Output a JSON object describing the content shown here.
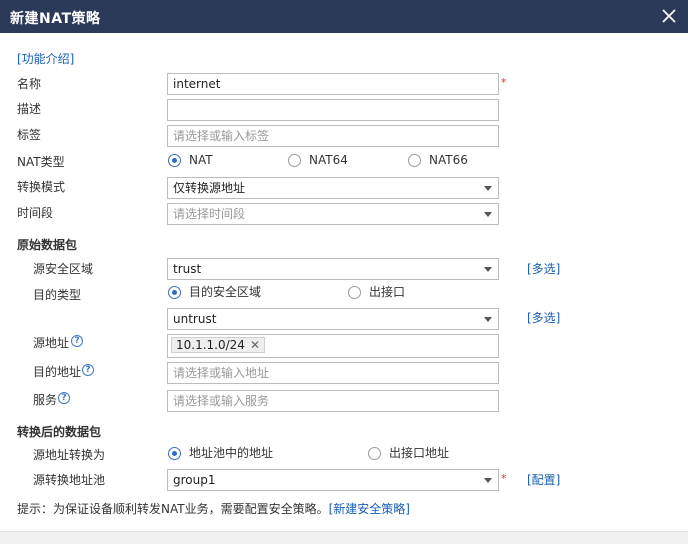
{
  "dialog": {
    "title": "新建NAT策略",
    "close_icon": "close-icon"
  },
  "help_link": "[功能介绍]",
  "name": {
    "label": "名称",
    "value": "internet",
    "required": "*"
  },
  "description": {
    "label": "描述",
    "value": ""
  },
  "tags": {
    "label": "标签",
    "placeholder": "请选择或输入标签"
  },
  "nat_type": {
    "label": "NAT类型",
    "options": [
      "NAT",
      "NAT64",
      "NAT66"
    ],
    "selected": "NAT"
  },
  "conversion_mode": {
    "label": "转换模式",
    "value": "仅转换源地址"
  },
  "time_range": {
    "label": "时间段",
    "placeholder": "请选择时间段"
  },
  "original_packet": {
    "title": "原始数据包",
    "source_zone": {
      "label": "源安全区域",
      "value": "trust",
      "multi_link": "[多选]"
    },
    "dest_type": {
      "label": "目的类型",
      "options": [
        "目的安全区域",
        "出接口"
      ],
      "selected": "目的安全区域"
    },
    "dest_zone": {
      "value": "untrust",
      "multi_link": "[多选]"
    },
    "source_address": {
      "label": "源地址",
      "tag": "10.1.1.0/24",
      "tag_remove": "✕"
    },
    "dest_address": {
      "label": "目的地址",
      "placeholder": "请选择或输入地址"
    },
    "service": {
      "label": "服务",
      "placeholder": "请选择或输入服务"
    }
  },
  "translated_packet": {
    "title": "转换后的数据包",
    "source_translate": {
      "label": "源地址转换为",
      "options": [
        "地址池中的地址",
        "出接口地址"
      ],
      "selected": "地址池中的地址"
    },
    "pool": {
      "label": "源转换地址池",
      "value": "group1",
      "required": "*",
      "config_link": "[配置]"
    }
  },
  "hint": {
    "text": "提示：为保证设备顺利转发NAT业务，需要配置安全策略。",
    "link": "[新建安全策略]"
  },
  "colors": {
    "titlebar_bg": "#2c3a59",
    "link": "#1a5fb4",
    "required": "#e03030",
    "radio_selected": "#2e6bc4"
  }
}
